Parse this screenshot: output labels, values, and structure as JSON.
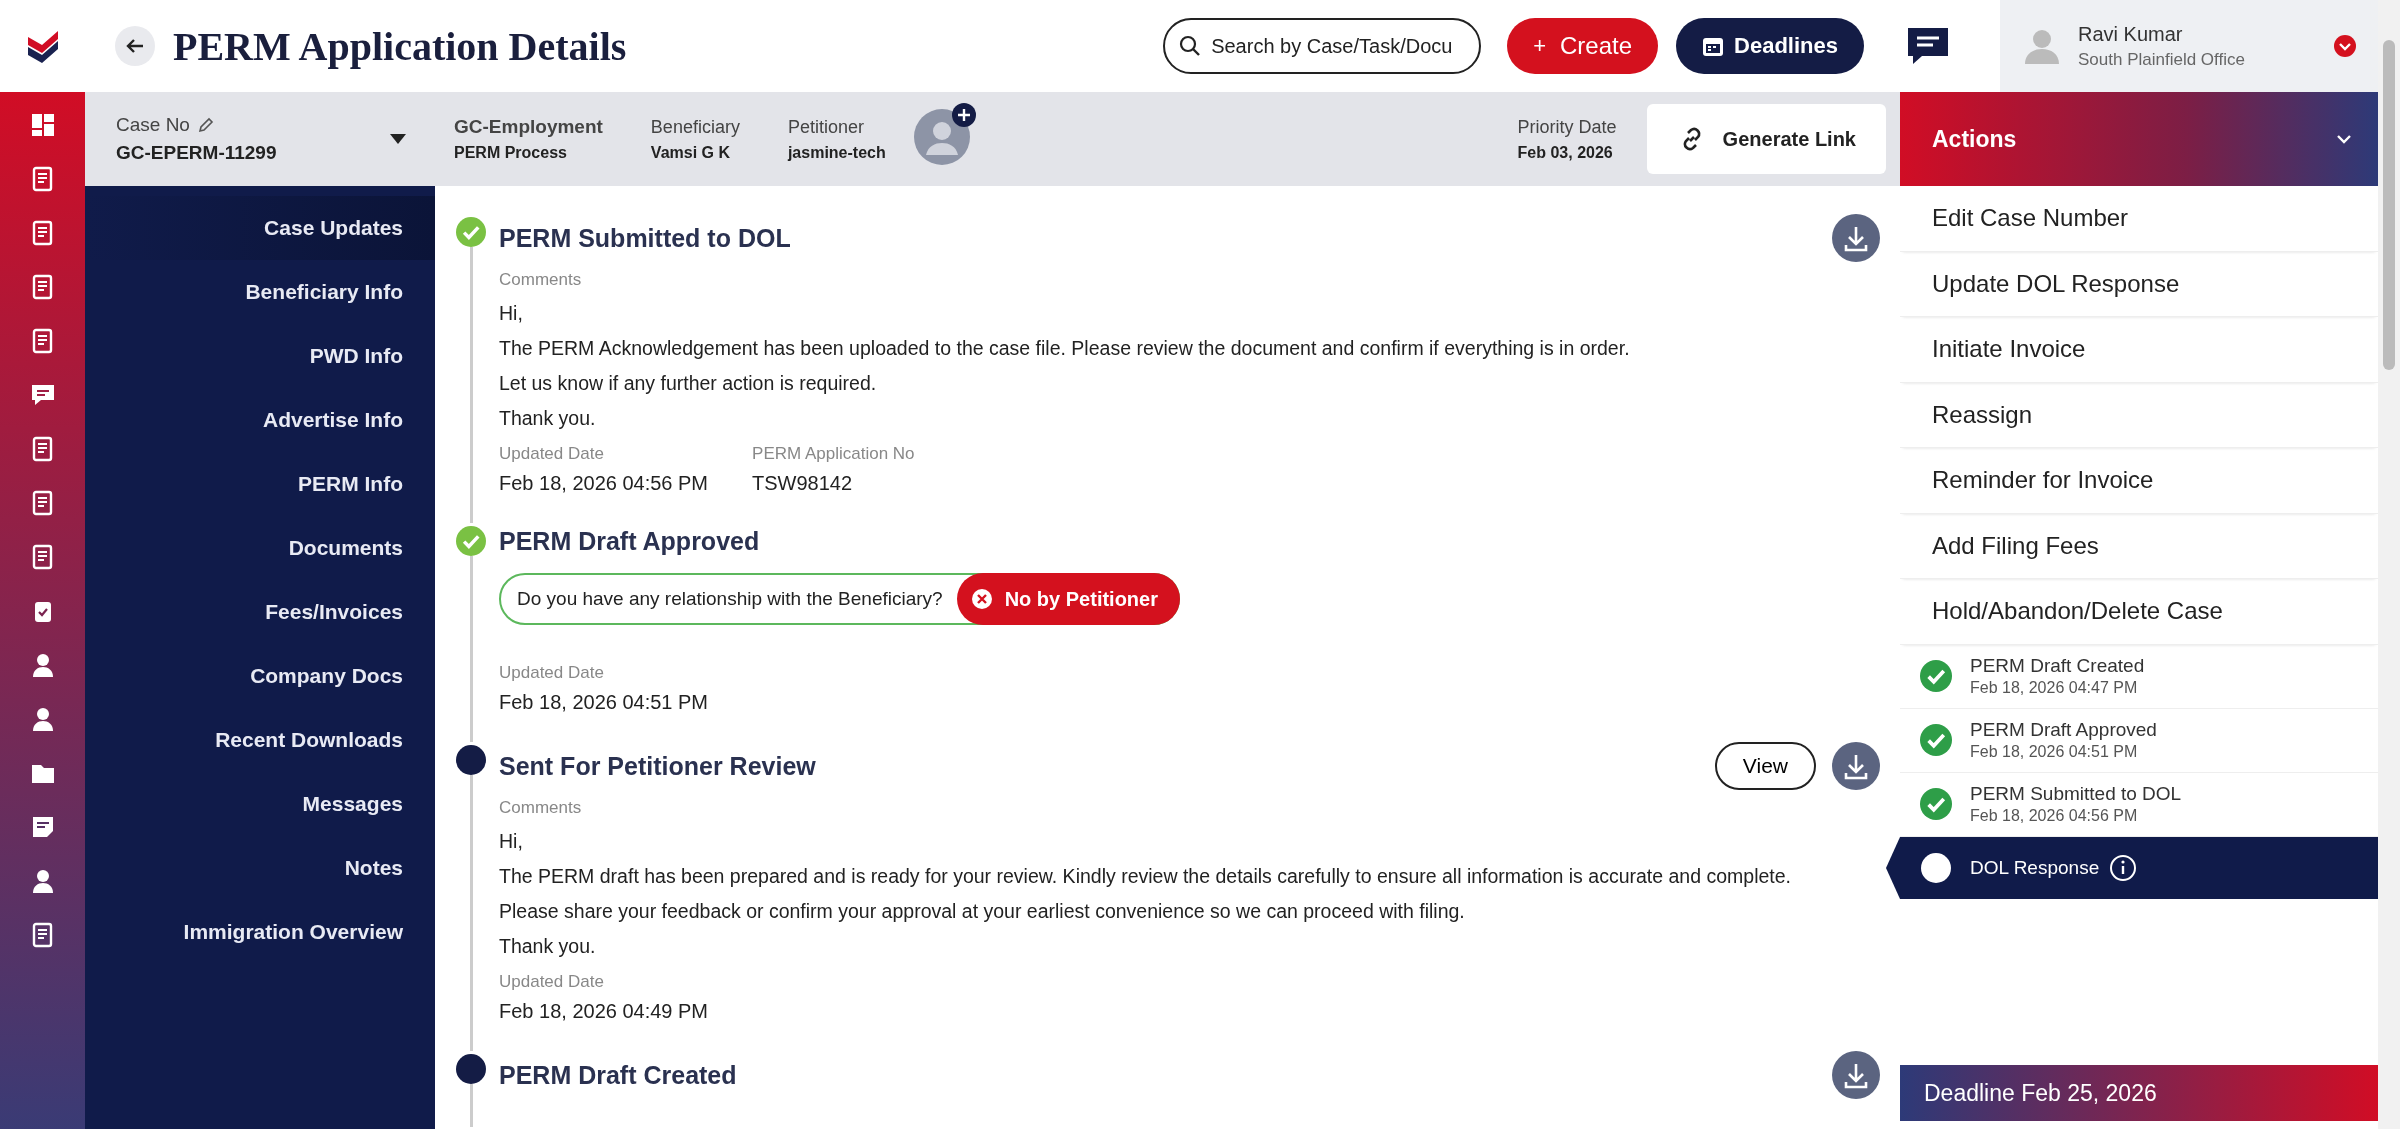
{
  "app": {
    "title": "PERM Application Details"
  },
  "topbar": {
    "search": {
      "placeholder": "Search by Case/Task/Docu"
    },
    "create_icon": "+",
    "create_button": "Create",
    "deadlines_button": "Deadlines",
    "user": {
      "name": "Ravi Kumar",
      "office": "South Plainfield Office"
    }
  },
  "case_header": {
    "case_no_label": "Case No",
    "case_no": "GC-EPERM-11299",
    "case_type": "GC-Employment",
    "process": "PERM Process",
    "beneficiary_label": "Beneficiary",
    "beneficiary": "Vamsi G K",
    "petitioner_label": "Petitioner",
    "petitioner": "jasmine-tech",
    "priority_date_label": "Priority Date",
    "priority_date": "Feb 03, 2026",
    "generate_link": "Generate Link"
  },
  "sidebar": {
    "items": [
      {
        "label": "Case Updates",
        "selected": true
      },
      {
        "label": "Beneficiary Info",
        "selected": false
      },
      {
        "label": "PWD Info",
        "selected": false
      },
      {
        "label": "Advertise Info",
        "selected": false
      },
      {
        "label": "PERM Info",
        "selected": false
      },
      {
        "label": "Documents",
        "selected": false
      },
      {
        "label": "Fees/Invoices",
        "selected": false
      },
      {
        "label": "Company Docs",
        "selected": false
      },
      {
        "label": "Recent Downloads",
        "selected": false
      },
      {
        "label": "Messages",
        "selected": false
      },
      {
        "label": "Notes",
        "selected": false
      },
      {
        "label": "Immigration Overview",
        "selected": false
      }
    ]
  },
  "timeline": [
    {
      "title": "PERM Submitted to DOL",
      "completed": true,
      "download": true,
      "comments_label": "Comments",
      "comment_lines": [
        "Hi,",
        "The PERM Acknowledgement has been uploaded to the case file. Please review the document and confirm if everything is in order.",
        "Let us know if any further action is required.",
        "Thank you."
      ],
      "fields": [
        {
          "label": "Updated Date",
          "value": "Feb 18, 2026 04:56 PM"
        },
        {
          "label": "PERM Application No",
          "value": "TSW98142"
        }
      ]
    },
    {
      "title": "PERM Draft Approved",
      "completed": true,
      "download": false,
      "question": {
        "text": "Do you have any relationship with the Beneficiary?",
        "answer": "No by Petitioner"
      },
      "fields": [
        {
          "label": "Updated Date",
          "value": "Feb 18, 2026 04:51 PM"
        }
      ]
    },
    {
      "title": "Sent For Petitioner Review",
      "completed": false,
      "download": true,
      "view_button": "View",
      "comments_label": "Comments",
      "comment_lines": [
        "Hi,",
        "The PERM draft has been prepared and is ready for your review. Kindly review the details carefully to ensure all information is accurate and complete.",
        "Please share your feedback or confirm your approval at your earliest convenience so we can proceed with filing.",
        "Thank you."
      ],
      "fields": [
        {
          "label": "Updated Date",
          "value": "Feb 18, 2026 04:49 PM"
        }
      ]
    },
    {
      "title": "PERM Draft Created",
      "completed": false,
      "download": true
    }
  ],
  "actions_panel": {
    "title": "Actions",
    "expanded": true,
    "items": [
      "Edit Case Number",
      "Update DOL Response",
      "Initiate Invoice",
      "Reassign",
      "Reminder for Invoice",
      "Add Filing Fees",
      "Hold/Abandon/Delete Case"
    ]
  },
  "progress": [
    {
      "title": "PERM Draft Created",
      "date": "Feb 18, 2026 04:47 PM",
      "completed": true,
      "selected": false
    },
    {
      "title": "PERM Draft Approved",
      "date": "Feb 18, 2026 04:51 PM",
      "completed": true,
      "selected": false
    },
    {
      "title": "PERM Submitted to DOL",
      "date": "Feb 18, 2026 04:56 PM",
      "completed": true,
      "selected": false
    },
    {
      "title": "DOL Response",
      "completed": false,
      "selected": true,
      "info": true
    }
  ],
  "deadline": "Deadline Feb 25, 2026"
}
